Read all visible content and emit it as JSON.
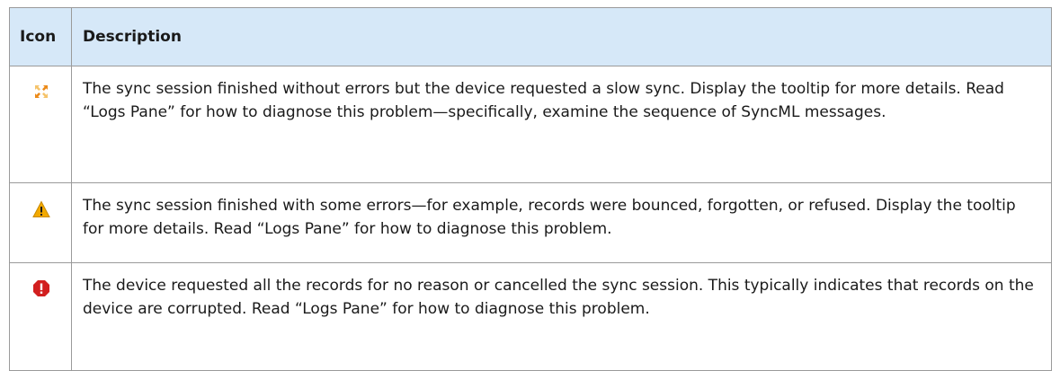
{
  "table": {
    "headers": {
      "icon": "Icon",
      "description": "Description"
    },
    "rows": [
      {
        "icon": "slow-sync-icon",
        "icon_color": "#f0a020",
        "description": "The sync session finished without errors but the device requested a slow sync. Display the tooltip for more details. Read “Logs Pane” for how to diagnose this problem—specifically, examine the sequence of SyncML messages."
      },
      {
        "icon": "warning-icon",
        "icon_color": "#f2a900",
        "description": "The sync session finished with some errors—for example, records were bounced, forgotten, or refused. Display the tooltip for more details. Read “Logs Pane” for how to diagnose this problem."
      },
      {
        "icon": "error-stop-icon",
        "icon_color": "#d21f1f",
        "description": "The device requested all the records for no reason or cancelled the sync session. This typically indicates that records on the device are corrupted. Read “Logs Pane” for how to diagnose this problem."
      }
    ]
  }
}
